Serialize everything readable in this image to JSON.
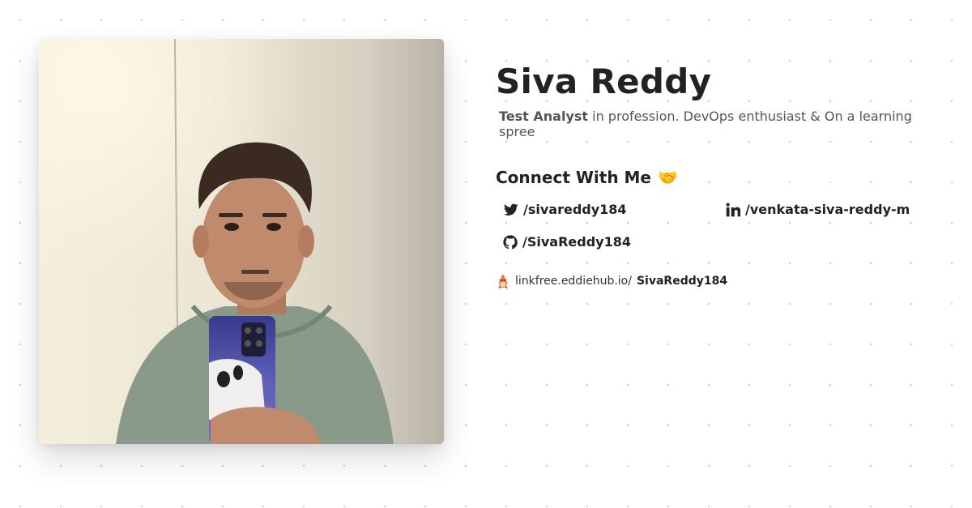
{
  "profile": {
    "photo_alt": "Profile photo",
    "name": "Siva Reddy",
    "bio_role": "Test Analyst",
    "bio_rest": " in profession. DevOps enthusiast & On a learning spree"
  },
  "connect": {
    "heading": "Connect With Me",
    "emoji": "🤝",
    "links": [
      {
        "icon": "twitter-icon",
        "label": "/sivareddy184"
      },
      {
        "icon": "linkedin-icon",
        "label": "/venkata-siva-reddy-m"
      },
      {
        "icon": "github-icon",
        "label": "/SivaReddy184"
      }
    ]
  },
  "linkfree": {
    "icon": "linkfree-mascot-icon",
    "prefix": "linkfree.eddiehub.io/",
    "username": "SivaReddy184"
  },
  "colors": {
    "text": "#222222",
    "muted": "#555555",
    "dots": "#c9c9c9"
  }
}
